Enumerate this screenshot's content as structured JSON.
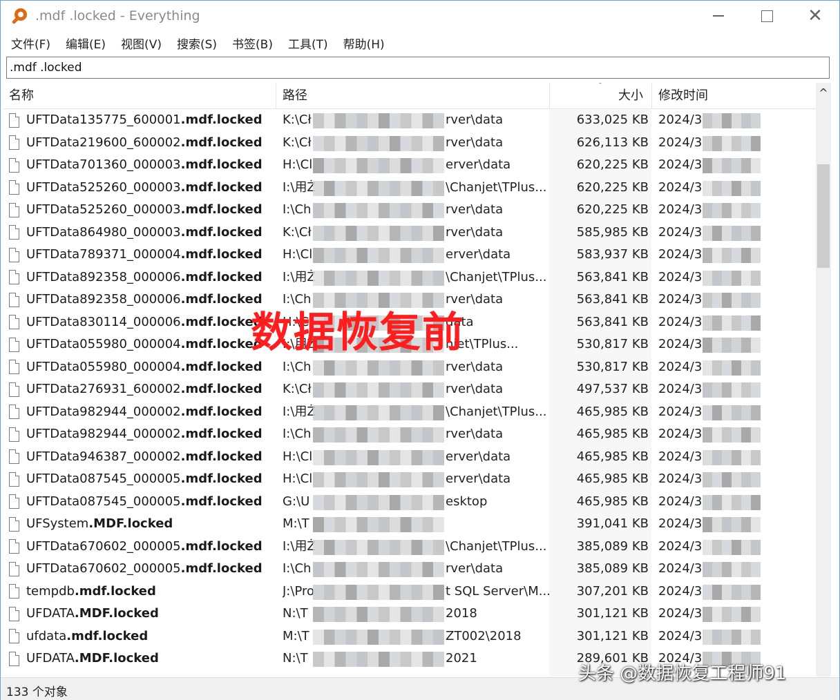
{
  "window": {
    "title": ".mdf .locked - Everything",
    "controls": {
      "minimize": "",
      "maximize": "",
      "close": "✕"
    }
  },
  "menu": {
    "items": [
      "文件(F)",
      "编辑(E)",
      "视图(V)",
      "搜索(S)",
      "书签(B)",
      "工具(T)",
      "帮助(H)"
    ]
  },
  "search": {
    "value": ".mdf .locked"
  },
  "columns": {
    "name": "名称",
    "path": "路径",
    "size": "大小",
    "modified": "修改时间"
  },
  "rows": [
    {
      "base": "UFTData135775_600001",
      "hl": ".mdf.locked",
      "path_start": "K:\\Cł",
      "path_end": "rver\\data",
      "size": "633,025 KB",
      "date": "2024/3"
    },
    {
      "base": "UFTData219600_600002",
      "hl": ".mdf.locked",
      "path_start": "K:\\Cł",
      "path_end": "rver\\data",
      "size": "626,113 KB",
      "date": "2024/3"
    },
    {
      "base": "UFTData701360_000003",
      "hl": ".mdf.locked",
      "path_start": "H:\\Cl",
      "path_end": "erver\\data",
      "size": "620,225 KB",
      "date": "2024/3"
    },
    {
      "base": "UFTData525260_000003",
      "hl": ".mdf.locked",
      "path_start": "I:\\用Ż",
      "path_end": "\\Chanjet\\TPlus...",
      "size": "620,225 KB",
      "date": "2024/3"
    },
    {
      "base": "UFTData525260_000003",
      "hl": ".mdf.locked",
      "path_start": "I:\\Ch",
      "path_end": "rver\\data",
      "size": "620,225 KB",
      "date": "2024/3"
    },
    {
      "base": "UFTData864980_000003",
      "hl": ".mdf.locked",
      "path_start": "K:\\Cł",
      "path_end": "rver\\data",
      "size": "585,985 KB",
      "date": "2024/3"
    },
    {
      "base": "UFTData789371_000004",
      "hl": ".mdf.locked",
      "path_start": "H:\\Cl",
      "path_end": "erver\\data",
      "size": "583,937 KB",
      "date": "2024/3"
    },
    {
      "base": "UFTData892358_000006",
      "hl": ".mdf.locked",
      "path_start": "I:\\用Ż",
      "path_end": "\\Chanjet\\TPlus...",
      "size": "563,841 KB",
      "date": "2024/3"
    },
    {
      "base": "UFTData892358_000006",
      "hl": ".mdf.locked",
      "path_start": "I:\\Ch",
      "path_end": "rver\\data",
      "size": "563,841 KB",
      "date": "2024/3"
    },
    {
      "base": "UFTData830114_000006",
      "hl": ".mdf.locked",
      "path_start": "H:\\Cl",
      "path_end": "data",
      "size": "563,841 KB",
      "date": "2024/3"
    },
    {
      "base": "UFTData055980_000004",
      "hl": ".mdf.locked",
      "path_start": "I:\\用Ż",
      "path_end": "njet\\TPlus...",
      "size": "530,817 KB",
      "date": "2024/3"
    },
    {
      "base": "UFTData055980_000004",
      "hl": ".mdf.locked",
      "path_start": "I:\\Ch",
      "path_end": "rver\\data",
      "size": "530,817 KB",
      "date": "2024/3"
    },
    {
      "base": "UFTData276931_600002",
      "hl": ".mdf.locked",
      "path_start": "K:\\Cł",
      "path_end": "rver\\data",
      "size": "497,537 KB",
      "date": "2024/3"
    },
    {
      "base": "UFTData982944_000002",
      "hl": ".mdf.locked",
      "path_start": "I:\\用Ż",
      "path_end": "\\Chanjet\\TPlus...",
      "size": "465,985 KB",
      "date": "2024/3"
    },
    {
      "base": "UFTData982944_000002",
      "hl": ".mdf.locked",
      "path_start": "I:\\Ch",
      "path_end": "rver\\data",
      "size": "465,985 KB",
      "date": "2024/3"
    },
    {
      "base": "UFTData946387_000002",
      "hl": ".mdf.locked",
      "path_start": "H:\\Cl",
      "path_end": "erver\\data",
      "size": "465,985 KB",
      "date": "2024/3"
    },
    {
      "base": "UFTData087545_000005",
      "hl": ".mdf.locked",
      "path_start": "H:\\Cl",
      "path_end": "erver\\data",
      "size": "465,985 KB",
      "date": "2024/3"
    },
    {
      "base": "UFTData087545_000005",
      "hl": ".mdf.locked",
      "path_start": "G:\\U",
      "path_end": "esktop",
      "size": "465,985 KB",
      "date": "2024/3"
    },
    {
      "base": "UFSystem",
      "hl": ".MDF.locked",
      "path_start": "M:\\T",
      "path_end": "",
      "size": "391,041 KB",
      "date": "2024/3"
    },
    {
      "base": "UFTData670602_000005",
      "hl": ".mdf.locked",
      "path_start": "I:\\用Ż",
      "path_end": "\\Chanjet\\TPlus...",
      "size": "385,089 KB",
      "date": "2024/3"
    },
    {
      "base": "UFTData670602_000005",
      "hl": ".mdf.locked",
      "path_start": "I:\\Ch",
      "path_end": "rver\\data",
      "size": "385,089 KB",
      "date": "2024/3"
    },
    {
      "base": "tempdb",
      "hl": ".mdf.locked",
      "path_start": "J:\\Pro",
      "path_end": "t SQL Server\\M...",
      "size": "307,201 KB",
      "date": "2024/3"
    },
    {
      "base": "UFDATA",
      "hl": ".MDF.locked",
      "path_start": "N:\\T",
      "path_end": "2018",
      "size": "301,121 KB",
      "date": "2024/3"
    },
    {
      "base": "ufdata",
      "hl": ".mdf.locked",
      "path_start": "M:\\T",
      "path_end": "ZT002\\2018",
      "size": "301,121 KB",
      "date": "2024/3"
    },
    {
      "base": "UFDATA",
      "hl": ".MDF.locked",
      "path_start": "N:\\T",
      "path_end": "2021",
      "size": "289,601 KB",
      "date": "2024/3"
    }
  ],
  "scrollbar": {
    "up_arrow": "^"
  },
  "status": {
    "text": "133 个对象"
  },
  "overlay": {
    "stamp": "数据恢复前",
    "watermark": "头条 @数据恢复工程师91"
  },
  "colors": {
    "accent": "#e06a10",
    "stamp": "#ff1d1d",
    "border": "#6f9fd8"
  }
}
